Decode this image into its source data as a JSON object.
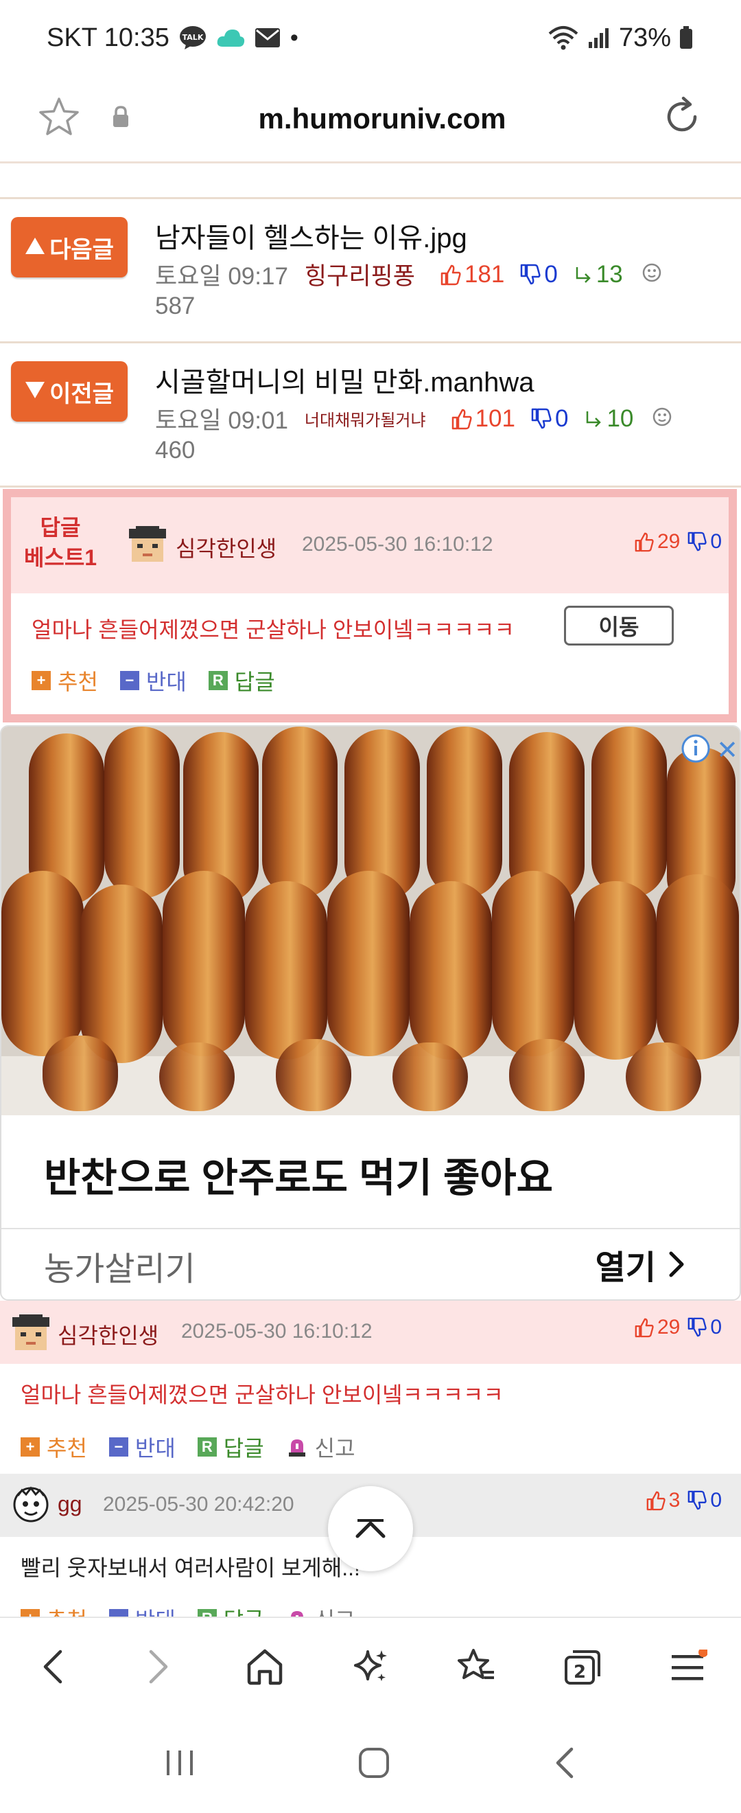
{
  "status_bar": {
    "carrier_time": "SKT 10:35",
    "talk_badge": "TALK",
    "dot": "•",
    "battery": "73%"
  },
  "url_bar": {
    "url": "m.humoruniv.com"
  },
  "next_post": {
    "button_label": "다음글",
    "title": "남자들이 헬스하는 이유.jpg",
    "time": "토요일 09:17",
    "author": "힝구리핑퐁",
    "upvotes": "181",
    "downvotes": "0",
    "replies": "13",
    "views": "587"
  },
  "prev_post": {
    "button_label": "이전글",
    "title": "시골할머니의 비밀 만화.manhwa",
    "time": "토요일 09:01",
    "author": "너대채뭐가될거냐",
    "upvotes": "101",
    "downvotes": "0",
    "replies": "10",
    "views": "460"
  },
  "best_comment": {
    "label_line1": "답글",
    "label_line2": "베스트1",
    "author": "심각한인생",
    "date": "2025-05-30 16:10:12",
    "upvotes": "29",
    "downvotes": "0",
    "text": "얼마나 흔들어제꼈으면 군살하나 안보이넼ㅋㅋㅋㅋㅋ",
    "move_label": "이동",
    "actions": {
      "recommend": "추천",
      "oppose": "반대",
      "reply": "답글",
      "reply_icon": "R"
    }
  },
  "ad": {
    "headline": "반찬으로 안주로도 먹기 좋아요",
    "sponsor": "농가살리기",
    "open_label": "열기"
  },
  "comments": [
    {
      "author": "심각한인생",
      "date": "2025-05-30 16:10:12",
      "upvotes": "29",
      "downvotes": "0",
      "text": "얼마나 흔들어제꼈으면 군살하나 안보이넼ㅋㅋㅋㅋㅋ",
      "actions": {
        "recommend": "추천",
        "oppose": "반대",
        "reply": "답글",
        "report": "신고"
      }
    },
    {
      "author": "gg",
      "date": "2025-05-30 20:42:20",
      "upvotes": "3",
      "downvotes": "0",
      "text": "빨리 웃자보내서 여러사람이 보게해..!",
      "actions": {
        "recommend": "추천",
        "oppose": "반대",
        "reply": "답글",
        "report": "신고"
      }
    }
  ],
  "toolbar": {
    "tab_count": "2"
  },
  "colors": {
    "accent_orange": "#e8642c",
    "author_red": "#8b1a1a",
    "upvote_red": "#e8442c",
    "downvote_blue": "#1a3bd0",
    "reply_green": "#3a8a2a",
    "best_border": "#f5b8b8",
    "best_bg": "#fde4e4"
  }
}
